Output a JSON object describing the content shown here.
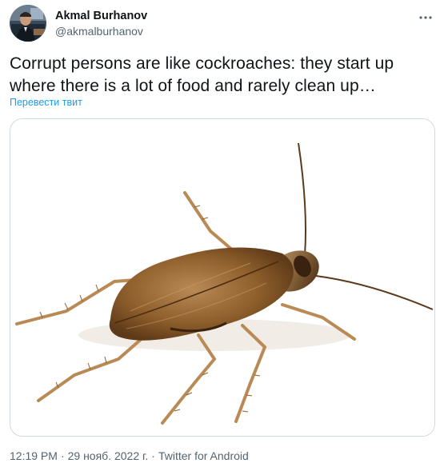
{
  "author": {
    "display_name": "Akmal Burhanov",
    "handle": "@akmalburhanov",
    "avatar_icon": "profile-photo"
  },
  "menu": {
    "icon": "more-horizontal-icon"
  },
  "tweet": {
    "text": "Corrupt persons are like cockroaches: they start up where there is a lot of food and rarely clean up…",
    "translate_label": "Перевести твит",
    "media_icon": "cockroach-photo"
  },
  "meta": {
    "time": "12:19 PM",
    "separator": "·",
    "date": "29 нояб. 2022 г.",
    "separator2": "·",
    "source": "Twitter for Android"
  },
  "colors": {
    "text": "#0f1419",
    "secondary": "#536471",
    "link": "#1d9bf0",
    "border": "#cfd9de"
  }
}
